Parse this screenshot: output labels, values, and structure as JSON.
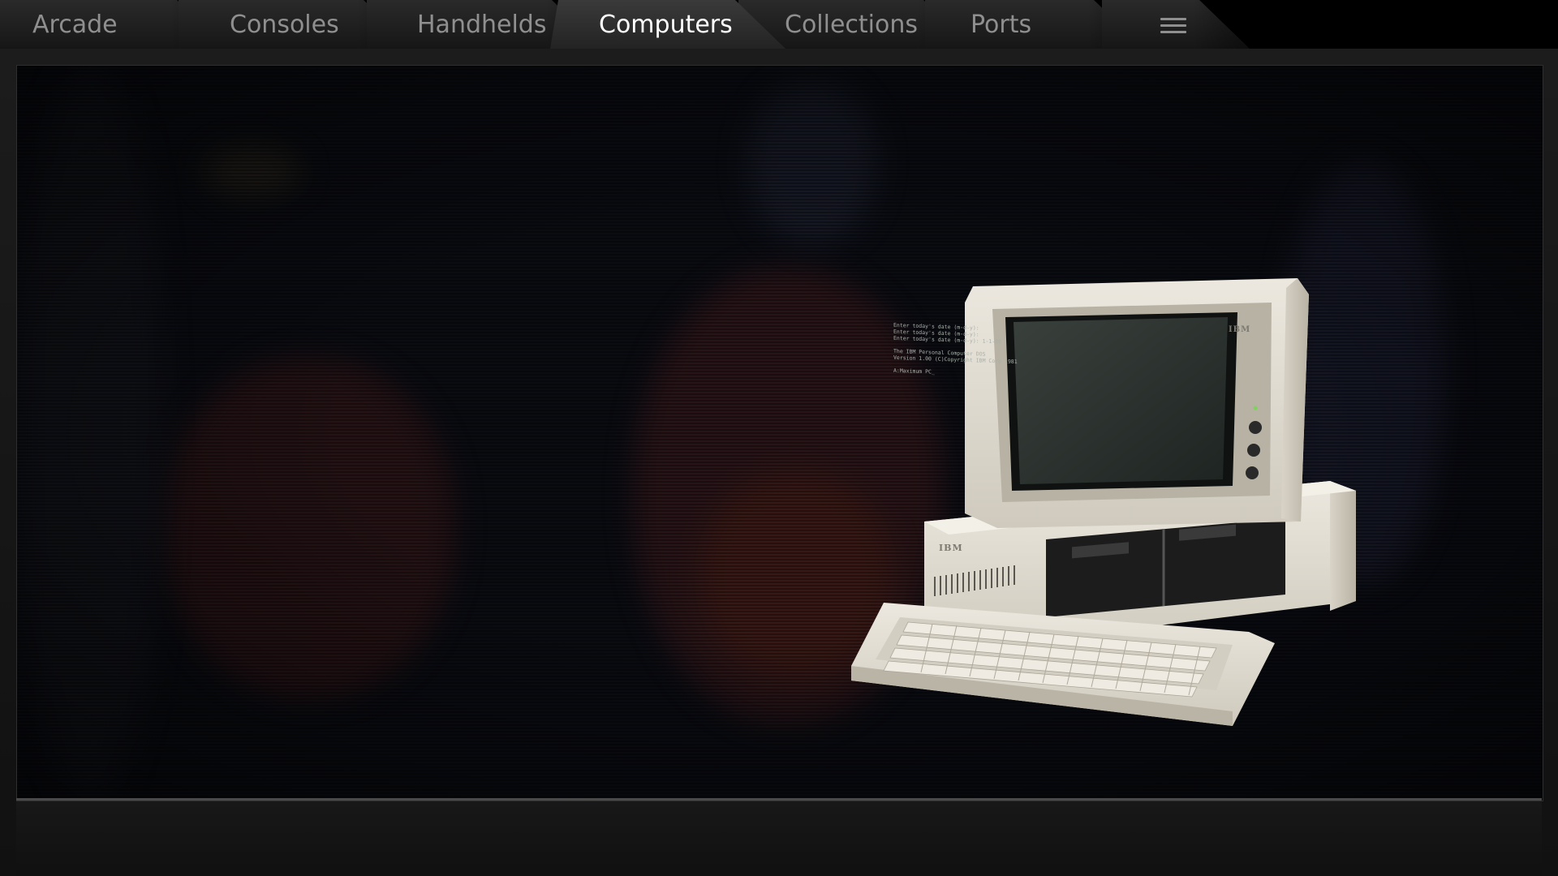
{
  "tabs": [
    {
      "label": "Arcade",
      "active": false
    },
    {
      "label": "Consoles",
      "active": false
    },
    {
      "label": "Handhelds",
      "active": false
    },
    {
      "label": "Computers",
      "active": true
    },
    {
      "label": "Collections",
      "active": false
    },
    {
      "label": "Ports",
      "active": false
    }
  ],
  "menu": {
    "icon": "hamburger-menu-icon"
  },
  "hero": {
    "monitor_badge": "IBM",
    "system_unit_badge": "IBM",
    "screen_text": [
      "Enter today's date (m-d-y):",
      "Enter today's date (m-d-y):",
      "Enter today's date (m-d-y): 1-1-88",
      "",
      "The IBM Personal Computer DOS",
      "Version 1.00 (C)Copyright IBM Corp 1981",
      "",
      "A:Maximum PC_"
    ]
  },
  "colors": {
    "tab_active_text": "#ffffff",
    "tab_text": "#8f8f8f",
    "background": "#0d0d0d",
    "computer_beige": "#e4e0d6"
  }
}
